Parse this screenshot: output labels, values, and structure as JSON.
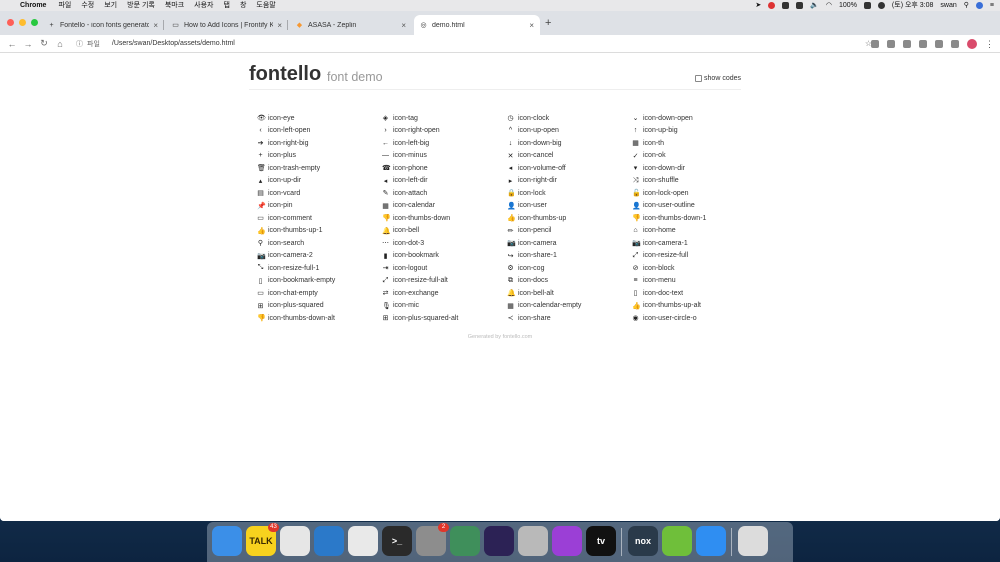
{
  "menubar": {
    "app_name": "Chrome",
    "menus": [
      "파일",
      "수정",
      "보기",
      "방문 기록",
      "북마크",
      "사용자",
      "탭",
      "창",
      "도움말"
    ],
    "battery": "100%",
    "clock": "(토) 오후 3:08",
    "user": "swan"
  },
  "tabs": [
    {
      "title": "Fontello - icon fonts generator",
      "icon": "plus-icon"
    },
    {
      "title": "How to Add Icons | Frontify Kn",
      "icon": "comment-icon"
    },
    {
      "title": "ASASA - Zeplin",
      "icon": "zeplin-icon"
    },
    {
      "title": "demo.html",
      "icon": "globe-icon"
    }
  ],
  "address_bar": {
    "scheme_label": "파일",
    "url": "/Users/swan/Desktop/assets/demo.html"
  },
  "page": {
    "brand": "fontello",
    "subtitle": "font demo",
    "show_codes_label": "show codes",
    "footer_prefix": "Generated by",
    "footer_link": "fontello.com",
    "columns": [
      [
        {
          "glyph": "👁",
          "label": "icon-eye"
        },
        {
          "glyph": "‹",
          "label": "icon-left-open"
        },
        {
          "glyph": "➔",
          "label": "icon-right-big"
        },
        {
          "glyph": "+",
          "label": "icon-plus"
        },
        {
          "glyph": "🗑",
          "label": "icon-trash-empty"
        },
        {
          "glyph": "▴",
          "label": "icon-up-dir"
        },
        {
          "glyph": "▤",
          "label": "icon-vcard"
        },
        {
          "glyph": "📌",
          "label": "icon-pin"
        },
        {
          "glyph": "▭",
          "label": "icon-comment"
        },
        {
          "glyph": "👍",
          "label": "icon-thumbs-up-1"
        },
        {
          "glyph": "⚲",
          "label": "icon-search"
        },
        {
          "glyph": "📷",
          "label": "icon-camera-2"
        },
        {
          "glyph": "⤡",
          "label": "icon-resize-full-1"
        },
        {
          "glyph": "▯",
          "label": "icon-bookmark-empty"
        },
        {
          "glyph": "▭",
          "label": "icon-chat-empty"
        },
        {
          "glyph": "⊞",
          "label": "icon-plus-squared"
        },
        {
          "glyph": "👎",
          "label": "icon-thumbs-down-alt"
        }
      ],
      [
        {
          "glyph": "◈",
          "label": "icon-tag"
        },
        {
          "glyph": "›",
          "label": "icon-right-open"
        },
        {
          "glyph": "←",
          "label": "icon-left-big"
        },
        {
          "glyph": "—",
          "label": "icon-minus"
        },
        {
          "glyph": "☎",
          "label": "icon-phone"
        },
        {
          "glyph": "◂",
          "label": "icon-left-dir"
        },
        {
          "glyph": "✎",
          "label": "icon-attach"
        },
        {
          "glyph": "▦",
          "label": "icon-calendar"
        },
        {
          "glyph": "👎",
          "label": "icon-thumbs-down"
        },
        {
          "glyph": "🔔",
          "label": "icon-bell"
        },
        {
          "glyph": "⋯",
          "label": "icon-dot-3"
        },
        {
          "glyph": "▮",
          "label": "icon-bookmark"
        },
        {
          "glyph": "⇥",
          "label": "icon-logout"
        },
        {
          "glyph": "⤢",
          "label": "icon-resize-full-alt"
        },
        {
          "glyph": "⇄",
          "label": "icon-exchange"
        },
        {
          "glyph": "🎙",
          "label": "icon-mic"
        },
        {
          "glyph": "⊞",
          "label": "icon-plus-squared-alt"
        }
      ],
      [
        {
          "glyph": "◷",
          "label": "icon-clock"
        },
        {
          "glyph": "^",
          "label": "icon-up-open"
        },
        {
          "glyph": "↓",
          "label": "icon-down-big"
        },
        {
          "glyph": "✕",
          "label": "icon-cancel"
        },
        {
          "glyph": "◂",
          "label": "icon-volume-off"
        },
        {
          "glyph": "▸",
          "label": "icon-right-dir"
        },
        {
          "glyph": "🔒",
          "label": "icon-lock"
        },
        {
          "glyph": "👤",
          "label": "icon-user"
        },
        {
          "glyph": "👍",
          "label": "icon-thumbs-up"
        },
        {
          "glyph": "✏",
          "label": "icon-pencil"
        },
        {
          "glyph": "📷",
          "label": "icon-camera"
        },
        {
          "glyph": "↪",
          "label": "icon-share-1"
        },
        {
          "glyph": "⚙",
          "label": "icon-cog"
        },
        {
          "glyph": "⧉",
          "label": "icon-docs"
        },
        {
          "glyph": "🔔",
          "label": "icon-bell-alt"
        },
        {
          "glyph": "▦",
          "label": "icon-calendar-empty"
        },
        {
          "glyph": "≺",
          "label": "icon-share"
        }
      ],
      [
        {
          "glyph": "⌄",
          "label": "icon-down-open"
        },
        {
          "glyph": "↑",
          "label": "icon-up-big"
        },
        {
          "glyph": "▦",
          "label": "icon-th"
        },
        {
          "glyph": "✓",
          "label": "icon-ok"
        },
        {
          "glyph": "▾",
          "label": "icon-down-dir"
        },
        {
          "glyph": "⤨",
          "label": "icon-shuffle"
        },
        {
          "glyph": "🔓",
          "label": "icon-lock-open"
        },
        {
          "glyph": "👤",
          "label": "icon-user-outline"
        },
        {
          "glyph": "👎",
          "label": "icon-thumbs-down-1"
        },
        {
          "glyph": "⌂",
          "label": "icon-home"
        },
        {
          "glyph": "📷",
          "label": "icon-camera-1"
        },
        {
          "glyph": "⤢",
          "label": "icon-resize-full"
        },
        {
          "glyph": "⊘",
          "label": "icon-block"
        },
        {
          "glyph": "≡",
          "label": "icon-menu"
        },
        {
          "glyph": "▯",
          "label": "icon-doc-text"
        },
        {
          "glyph": "👍",
          "label": "icon-thumbs-up-alt"
        },
        {
          "glyph": "◉",
          "label": "icon-user-circle-o"
        }
      ]
    ]
  },
  "dock": [
    {
      "name": "finder",
      "label": "",
      "color": "#3b8fe8"
    },
    {
      "name": "kakaotalk",
      "label": "TALK",
      "color": "#f7d21e",
      "badge": "43"
    },
    {
      "name": "chrome",
      "label": "",
      "color": "#e6e6e6"
    },
    {
      "name": "vscode",
      "label": "",
      "color": "#2b79c9"
    },
    {
      "name": "blocked-app",
      "label": "",
      "color": "#e9e9e9"
    },
    {
      "name": "terminal",
      "label": ">_",
      "color": "#2a2a2a"
    },
    {
      "name": "system-preferences",
      "label": "",
      "color": "#8d8d8d",
      "badge": "2"
    },
    {
      "name": "android-studio",
      "label": "",
      "color": "#3f8f5b"
    },
    {
      "name": "eclipse",
      "label": "",
      "color": "#2c2255"
    },
    {
      "name": "automator",
      "label": "",
      "color": "#b9b9b9"
    },
    {
      "name": "podcasts",
      "label": "",
      "color": "#9b3fd6"
    },
    {
      "name": "apple-tv",
      "label": "tv",
      "color": "#111111"
    },
    {
      "name": "nox",
      "label": "nox",
      "color": "#2a3a4a"
    },
    {
      "name": "bluestacks",
      "label": "",
      "color": "#6fbf3a"
    },
    {
      "name": "safari",
      "label": "",
      "color": "#2f8ef2"
    },
    {
      "name": "trash",
      "label": "",
      "color": "#dcdcdc"
    }
  ]
}
